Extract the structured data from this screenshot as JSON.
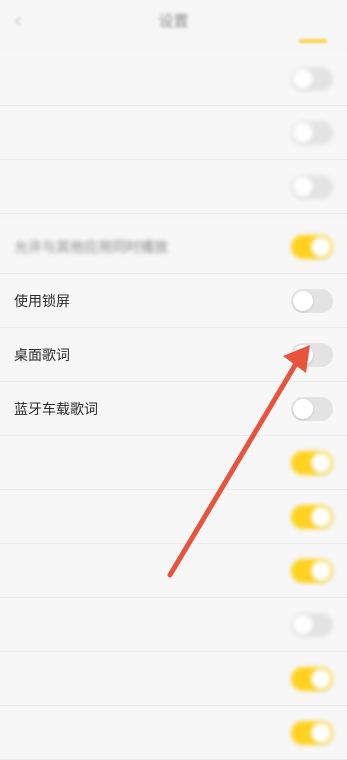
{
  "header": {
    "back_icon": "chevron-left-icon",
    "title": "设置"
  },
  "accent_color": "#ffd21f",
  "annotation_color": "#e8533d",
  "rows": [
    {
      "label": "",
      "on": false,
      "blurred": true
    },
    {
      "label": "",
      "on": false,
      "blurred": true
    },
    {
      "label": "",
      "on": false,
      "blurred": true
    },
    {
      "label": "允许与其他应用同时播放",
      "on": true,
      "blurred": true
    },
    {
      "label": "使用锁屏",
      "on": false,
      "blurred": false
    },
    {
      "label": "桌面歌词",
      "on": false,
      "blurred": false
    },
    {
      "label": "蓝牙车载歌词",
      "on": false,
      "blurred": false
    },
    {
      "label": "",
      "on": true,
      "blurred": true
    },
    {
      "label": "",
      "on": true,
      "blurred": true
    },
    {
      "label": "",
      "on": true,
      "blurred": true
    },
    {
      "label": "",
      "on": false,
      "blurred": true
    },
    {
      "label": "",
      "on": true,
      "blurred": true
    },
    {
      "label": "",
      "on": true,
      "blurred": true
    }
  ]
}
